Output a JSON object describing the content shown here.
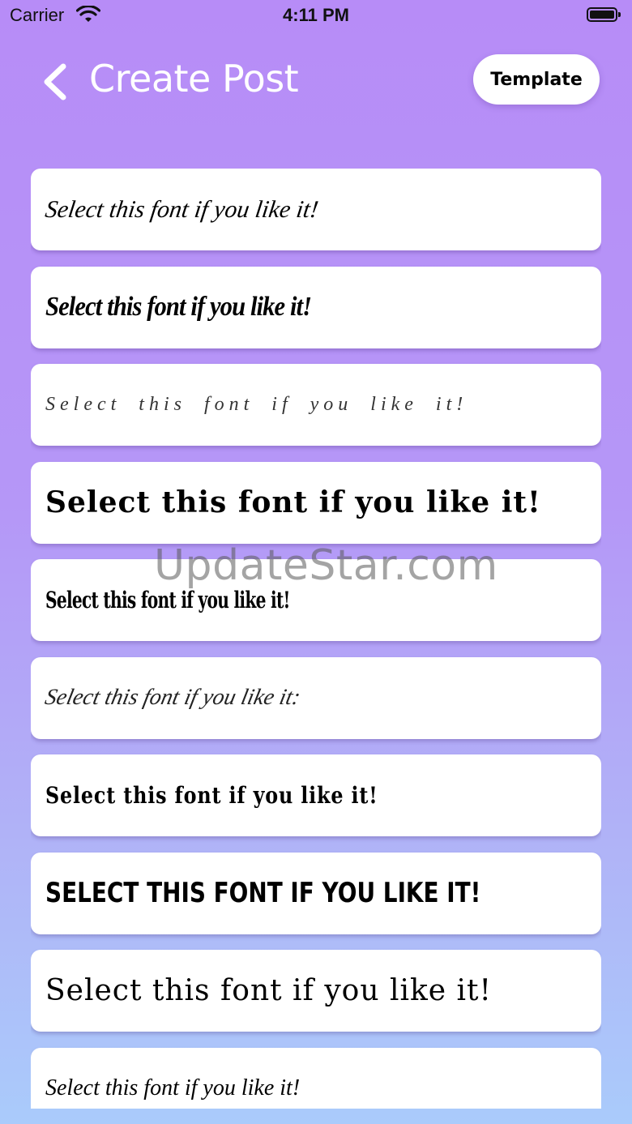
{
  "status_bar": {
    "carrier": "Carrier",
    "time": "4:11 PM"
  },
  "header": {
    "title": "Create Post",
    "template_label": "Template"
  },
  "font_samples": [
    "Select this font if you like it!",
    "Select this font if you like it!",
    "Select this font if you like it!",
    "Select this font if you like it!",
    "Select this font if you like it!",
    "Select this font if you like it:",
    "Select this font if you like it!",
    "Select this font if you like it!",
    "Select this font if you like it!",
    "Select this font if you like it!"
  ],
  "watermark": "UpdateStar.com",
  "icons": {
    "back": "chevron-left-icon",
    "wifi": "wifi-icon",
    "battery": "battery-icon"
  },
  "colors": {
    "gradient_top": "#b78cf7",
    "gradient_bottom": "#aacbfb",
    "card": "#ffffff",
    "title": "#ffffff"
  }
}
